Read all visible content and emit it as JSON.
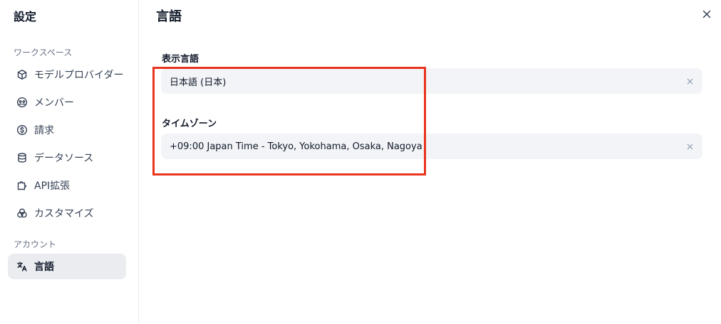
{
  "sidebar": {
    "title": "設定",
    "workspace_label": "ワークスペース",
    "account_label": "アカウント",
    "items": [
      {
        "label": "モデルプロバイダー",
        "icon": "cube-icon"
      },
      {
        "label": "メンバー",
        "icon": "members-icon"
      },
      {
        "label": "請求",
        "icon": "dollar-circle-icon"
      },
      {
        "label": "データソース",
        "icon": "database-icon"
      },
      {
        "label": "API拡張",
        "icon": "puzzle-icon"
      },
      {
        "label": "カスタマイズ",
        "icon": "palette-circles-icon"
      }
    ],
    "account_items": [
      {
        "label": "言語",
        "icon": "translate-icon",
        "active": true
      }
    ]
  },
  "main": {
    "title": "言語",
    "display_language": {
      "label": "表示言語",
      "value": "日本語 (日本)"
    },
    "timezone": {
      "label": "タイムゾーン",
      "value": "+09:00 Japan Time - Tokyo, Yokohama, Osaka, Nagoya"
    }
  },
  "colors": {
    "highlight": "#e8341c",
    "active_bg": "#eaecf0",
    "field_bg": "#f2f4f7"
  }
}
